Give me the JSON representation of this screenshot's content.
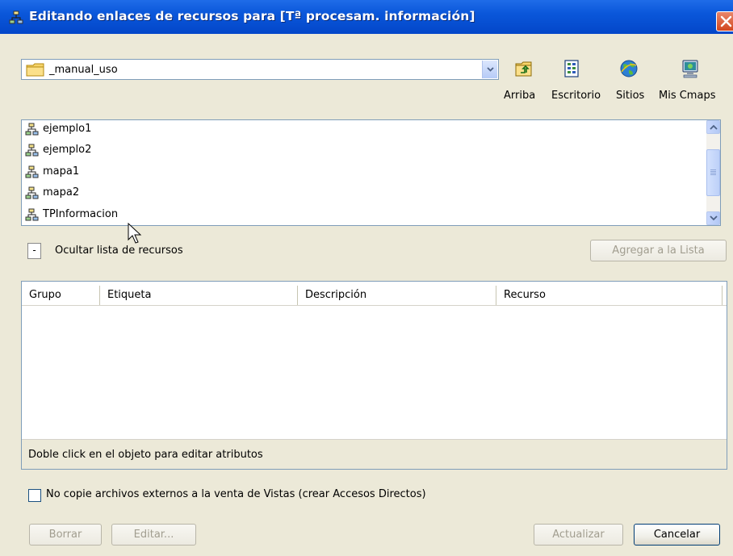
{
  "window": {
    "title": "Editando enlaces de recursos para [Tª procesam. información]"
  },
  "folder": {
    "value": "_manual_uso"
  },
  "nav": {
    "up": "Arriba",
    "desktop": "Escritorio",
    "sites": "Sitios",
    "mycmaps": "Mis Cmaps"
  },
  "resources": [
    {
      "label": "ejemplo1"
    },
    {
      "label": "ejemplo2"
    },
    {
      "label": "mapa1"
    },
    {
      "label": "mapa2"
    },
    {
      "label": "TPInformacion"
    }
  ],
  "toggle": {
    "symbol": "-",
    "label": "Ocultar lista de recursos"
  },
  "add_button": "Agregar a la Lista",
  "table": {
    "columns": [
      "Grupo",
      "Etiqueta",
      "Descripción",
      "Recurso"
    ],
    "status": "Doble click en el objeto para editar atributos"
  },
  "options": {
    "nocopy_label": "No copie archivos externos a la venta de Vistas (crear Accesos Directos)",
    "nocopy_checked": false
  },
  "buttons": {
    "delete": "Borrar",
    "edit": "Editar...",
    "update": "Actualizar",
    "cancel": "Cancelar"
  },
  "colors": {
    "titlebar": "#0A57DA",
    "dialog_bg": "#ECE9D8",
    "close_button": "#D2461E",
    "border_blue": "#7F9DB9"
  },
  "icons": {
    "title": "cmap-icon",
    "folder": "folder-icon",
    "up": "folder-up-icon",
    "desktop": "desktop-icon",
    "sites": "globe-icon",
    "mycmaps": "computer-icon",
    "resource": "cmap-icon"
  }
}
